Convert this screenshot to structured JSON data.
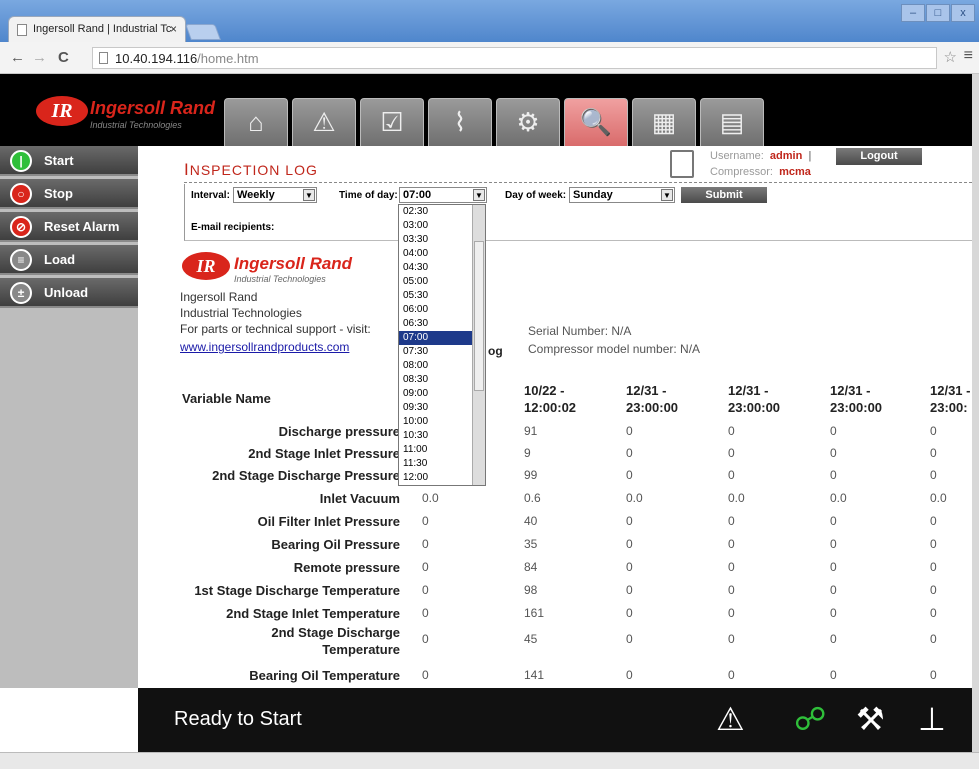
{
  "browser": {
    "tab_title": "Ingersoll Rand | Industrial Tc",
    "tab_close": "×",
    "url_host": "10.40.194.116",
    "url_path": "/home.htm",
    "window_buttons": [
      "–",
      "□",
      "x"
    ],
    "nav": {
      "back": "←",
      "forward": "→",
      "reload": "C"
    },
    "star": "☆",
    "menu": "≡"
  },
  "header": {
    "logo_mark": "IR",
    "logo_name": "Ingersoll Rand",
    "logo_sub": "Industrial Technologies",
    "tabs": [
      {
        "name": "home-icon",
        "glyph": "⌂"
      },
      {
        "name": "alarm-icon",
        "glyph": "⚠"
      },
      {
        "name": "checklist-icon",
        "glyph": "☑"
      },
      {
        "name": "trend-chart-icon",
        "glyph": "⌇"
      },
      {
        "name": "settings-icon",
        "glyph": "⚙"
      },
      {
        "name": "inspection-log-icon",
        "glyph": "🔍"
      },
      {
        "name": "panel-icon",
        "glyph": "▦"
      },
      {
        "name": "contact-card-icon",
        "glyph": "▤"
      }
    ],
    "active_tab_index": 5
  },
  "sidebar": {
    "buttons": [
      {
        "label": "Start",
        "icon": "start-icon",
        "glyph": "|",
        "color": "#2fbf3a"
      },
      {
        "label": "Stop",
        "icon": "stop-icon",
        "glyph": "○",
        "color": "#d9251b"
      },
      {
        "label": "Reset Alarm",
        "icon": "reset-alarm-icon",
        "glyph": "⊘",
        "color": "#d9251b"
      },
      {
        "label": "Load",
        "icon": "load-icon",
        "glyph": "≡",
        "color": "#888888"
      },
      {
        "label": "Unload",
        "icon": "unload-icon",
        "glyph": "±",
        "color": "#888888"
      }
    ]
  },
  "page": {
    "title_big": "I",
    "title_rest": "NSPECTION LOG",
    "username_label": "Username:",
    "username": "admin",
    "separator": "|",
    "compressor_label": "Compressor:",
    "compressor": "mcma",
    "logout": "Logout",
    "filters": {
      "interval_label": "Interval:",
      "interval_value": "Weekly",
      "time_label": "Time of day:",
      "time_value": "07:00",
      "dow_label": "Day of week:",
      "dow_value": "Sunday",
      "submit": "Submit",
      "email_label": "E-mail recipients:"
    },
    "time_options": [
      "02:30",
      "03:00",
      "03:30",
      "04:00",
      "04:30",
      "05:00",
      "05:30",
      "06:00",
      "06:30",
      "07:00",
      "07:30",
      "08:00",
      "08:30",
      "09:00",
      "09:30",
      "10:00",
      "10:30",
      "11:00",
      "11:30",
      "12:00"
    ],
    "selected_time": "07:00",
    "report": {
      "logo_mark": "IR",
      "logo_name": "Ingersoll Rand",
      "logo_sub": "Industrial Technologies",
      "company": "Ingersoll Rand",
      "division": "Industrial Technologies",
      "support": "For parts or technical support - visit:",
      "link": "www.ingersollrandproducts.com",
      "log_fragment": "og",
      "serial": "Serial Number: N/A",
      "model": "Compressor model number: N/A"
    },
    "table": {
      "name_header": "Variable Name",
      "column_headers": [
        [
          "10/22 -",
          "12:00:02"
        ],
        [
          "12/31 -",
          "23:00:00"
        ],
        [
          "12/31 -",
          "23:00:00"
        ],
        [
          "12/31 -",
          "23:00:00"
        ],
        [
          "12/31 -",
          "23:00:"
        ]
      ],
      "rows": [
        {
          "name": "Discharge pressure",
          "first": "",
          "vals": [
            "91",
            "0",
            "0",
            "0",
            "0"
          ]
        },
        {
          "name": "2nd Stage Inlet Pressure",
          "first": "",
          "vals": [
            "9",
            "0",
            "0",
            "0",
            "0"
          ]
        },
        {
          "name": "2nd Stage Discharge Pressure",
          "first": "",
          "vals": [
            "99",
            "0",
            "0",
            "0",
            "0"
          ]
        },
        {
          "name": "Inlet Vacuum",
          "first": "0.0",
          "vals": [
            "0.6",
            "0.0",
            "0.0",
            "0.0",
            "0.0"
          ]
        },
        {
          "name": "Oil Filter Inlet Pressure",
          "first": "0",
          "vals": [
            "40",
            "0",
            "0",
            "0",
            "0"
          ]
        },
        {
          "name": "Bearing Oil Pressure",
          "first": "0",
          "vals": [
            "35",
            "0",
            "0",
            "0",
            "0"
          ]
        },
        {
          "name": "Remote pressure",
          "first": "0",
          "vals": [
            "84",
            "0",
            "0",
            "0",
            "0"
          ]
        },
        {
          "name": "1st Stage Discharge Temperature",
          "first": "0",
          "vals": [
            "98",
            "0",
            "0",
            "0",
            "0"
          ]
        },
        {
          "name": "2nd Stage Inlet Temperature",
          "first": "0",
          "vals": [
            "161",
            "0",
            "0",
            "0",
            "0"
          ]
        },
        {
          "name": "2nd Stage Discharge Temperature",
          "first": "0",
          "vals": [
            "45",
            "0",
            "0",
            "0",
            "0"
          ]
        },
        {
          "name": "Bearing Oil Temperature",
          "first": "0",
          "vals": [
            "141",
            "0",
            "0",
            "0",
            "0"
          ]
        }
      ]
    }
  },
  "footer": {
    "status": "Ready to Start",
    "icons": [
      {
        "name": "warning-icon",
        "glyph": "⚠",
        "color": "#ffffff"
      },
      {
        "name": "network-icon",
        "glyph": "☍",
        "color": "#2fbf3a"
      },
      {
        "name": "service-tools-icon",
        "glyph": "⚒",
        "color": "#ffffff"
      },
      {
        "name": "unload-valve-icon",
        "glyph": "⊥",
        "color": "#ffffff"
      }
    ]
  }
}
